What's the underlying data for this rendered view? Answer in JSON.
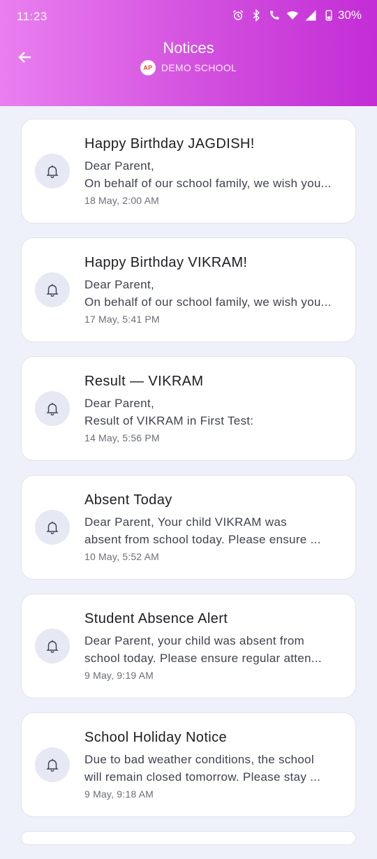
{
  "status_bar": {
    "time": "11:23",
    "battery": "30%",
    "icons": [
      "alarm-icon",
      "bluetooth-icon",
      "wifi-calling-icon",
      "wifi-icon",
      "signal-icon",
      "battery-icon"
    ]
  },
  "header": {
    "title": "Notices",
    "school_name": "DEMO SCHOOL",
    "back_icon": "arrow-left-icon",
    "gradient_colors": [
      "#ea7ff0",
      "#c32dd6"
    ]
  },
  "notices": [
    {
      "title": "Happy Birthday JAGDISH!",
      "line1": "Dear Parent,",
      "line2": "On behalf of our school family, we wish you...",
      "time": "18 May, 2:00 AM"
    },
    {
      "title": "Happy Birthday VIKRAM!",
      "line1": "Dear Parent,",
      "line2": "On behalf of our school family, we wish you...",
      "time": "17 May, 5:41 PM"
    },
    {
      "title": "Result — VIKRAM",
      "line1": "Dear Parent,",
      "line2": "Result of VIKRAM in First Test:",
      "time": "14 May, 5:56 PM"
    },
    {
      "title": "Absent Today",
      "line1": "Dear Parent, Your child VIKRAM was",
      "line2": "absent from school today. Please ensure ...",
      "time": "10 May, 5:52 AM"
    },
    {
      "title": "Student Absence Alert",
      "line1": "Dear Parent, your child was absent from",
      "line2": "school today. Please ensure regular atten...",
      "time": "9 May, 9:19 AM"
    },
    {
      "title": "School Holiday Notice",
      "line1": "Due to bad weather conditions, the school",
      "line2": "will remain closed tomorrow. Please stay ...",
      "time": "9 May, 9:18 AM"
    }
  ]
}
